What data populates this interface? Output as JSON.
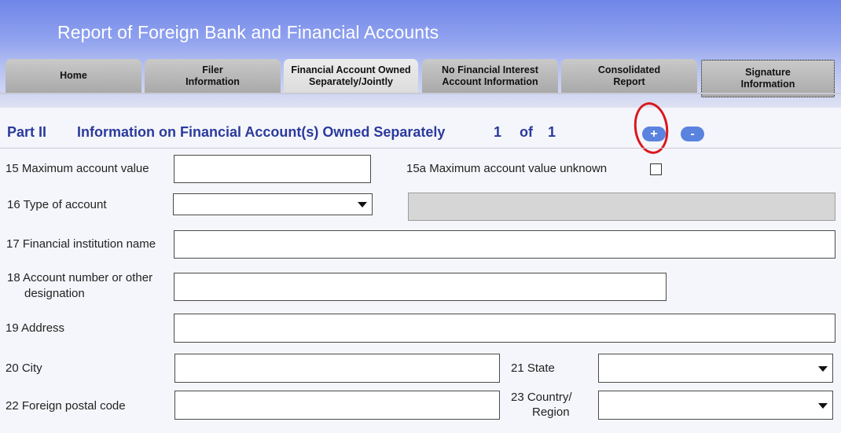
{
  "header": {
    "title": "Report of Foreign Bank and Financial Accounts"
  },
  "tabs": [
    {
      "label": "Home"
    },
    {
      "label": "Filer\nInformation"
    },
    {
      "label": "Financial Account Owned\nSeparately/Jointly"
    },
    {
      "label": "No Financial Interest\nAccount Information"
    },
    {
      "label": "Consolidated\nReport"
    },
    {
      "label": "Signature\nInformation"
    }
  ],
  "section": {
    "part": "Part II",
    "title": "Information on Financial Account(s) Owned Separately",
    "current": "1",
    "of_label": "of",
    "total": "1",
    "add_symbol": "+",
    "remove_symbol": "-"
  },
  "fields": {
    "max_value_label": "15 Maximum account value",
    "max_value_unknown_label": "15a Maximum account value unknown",
    "type_label": "16 Type of account",
    "institution_label": "17 Financial institution name",
    "account_number_label_1": "18 Account number or other",
    "account_number_label_2": "designation",
    "address_label": "19  Address",
    "city_label": "20  City",
    "state_label": "21 State",
    "postal_label": "22 Foreign postal code",
    "country_label_1": "23 Country/",
    "country_label_2": "Region"
  },
  "colors": {
    "accent": "#2b3a9c",
    "pill_button": "#5a82df",
    "annotation": "#d9181e"
  }
}
